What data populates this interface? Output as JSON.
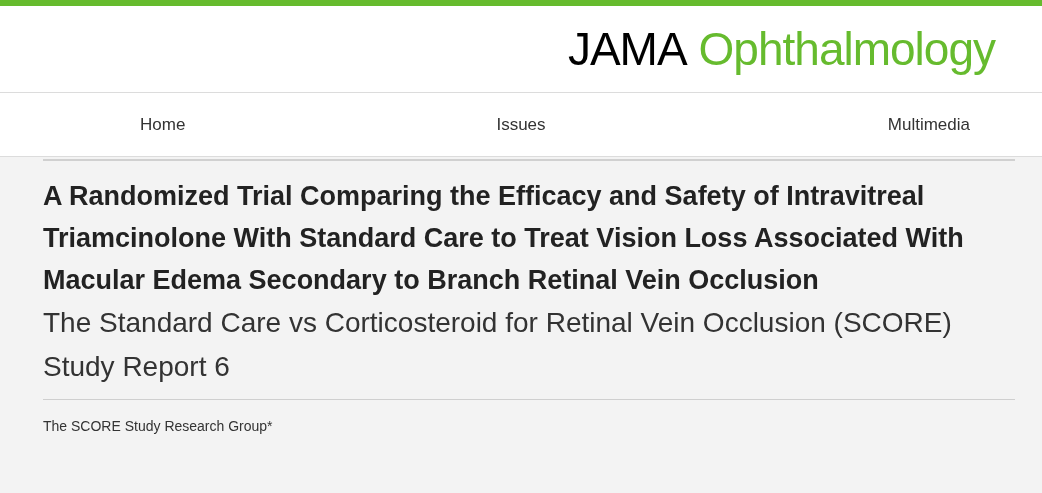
{
  "logo": {
    "primary": "JAMA",
    "secondary": "Ophthalmology"
  },
  "nav": [
    {
      "label": "Home"
    },
    {
      "label": "Issues"
    },
    {
      "label": "Multimedia"
    }
  ],
  "article": {
    "title": "A Randomized Trial Comparing the Efficacy and Safety of Intravitreal Triamcinolone With Standard Care to Treat Vision Loss Associated With Macular Edema Secondary to Branch Retinal Vein Occlusion",
    "subtitle": "The Standard Care vs Corticosteroid for Retinal Vein Occlusion (SCORE) Study Report 6",
    "authors": "The SCORE Study Research Group*"
  }
}
